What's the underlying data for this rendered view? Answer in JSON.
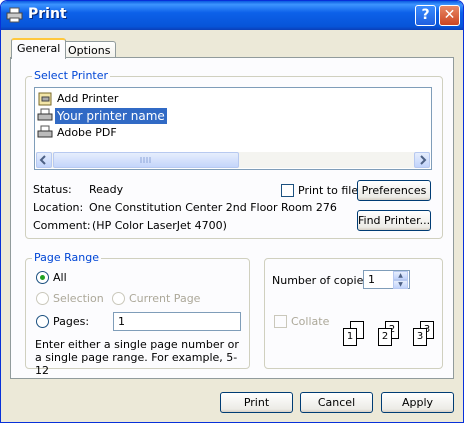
{
  "window": {
    "title": "Print",
    "help_button": "?",
    "close_button": "✕"
  },
  "tabs": [
    {
      "label": "General",
      "active": true
    },
    {
      "label": "Options",
      "active": false
    }
  ],
  "select_printer": {
    "title": "Select Printer",
    "printers": [
      {
        "label": "Add Printer",
        "icon": "add-printer-icon",
        "selected": false
      },
      {
        "label": "Your printer name",
        "icon": "printer-icon",
        "selected": true
      },
      {
        "label": "Adobe PDF",
        "icon": "printer-icon",
        "selected": false
      }
    ],
    "status_label": "Status:",
    "status_value": "Ready",
    "location_label": "Location:",
    "location_value": "One Constitution  Center  2nd Floor  Room 276",
    "comment_label": "Comment:",
    "comment_value": "(HP Color LaserJet 4700)",
    "print_to_file_label": "Print to file",
    "preferences_button": "Preferences",
    "find_printer_button": "Find Printer..."
  },
  "page_range": {
    "title": "Page Range",
    "all_label": "All",
    "selection_label": "Selection",
    "current_page_label": "Current Page",
    "pages_label": "Pages:",
    "pages_value": "1",
    "hint": "Enter either a single page number or a single page range.  For example, 5-12"
  },
  "copies": {
    "number_label": "Number of copies:",
    "number_value": "1",
    "collate_label": "Collate",
    "collate_pages": [
      "1",
      "1",
      "2",
      "2",
      "3",
      "3"
    ]
  },
  "footer": {
    "print_button": "Print",
    "cancel_button": "Cancel",
    "apply_button": "Apply"
  },
  "colors": {
    "titlebar": "#0754d8",
    "group_title": "#0046d5",
    "selection": "#316ac5"
  }
}
